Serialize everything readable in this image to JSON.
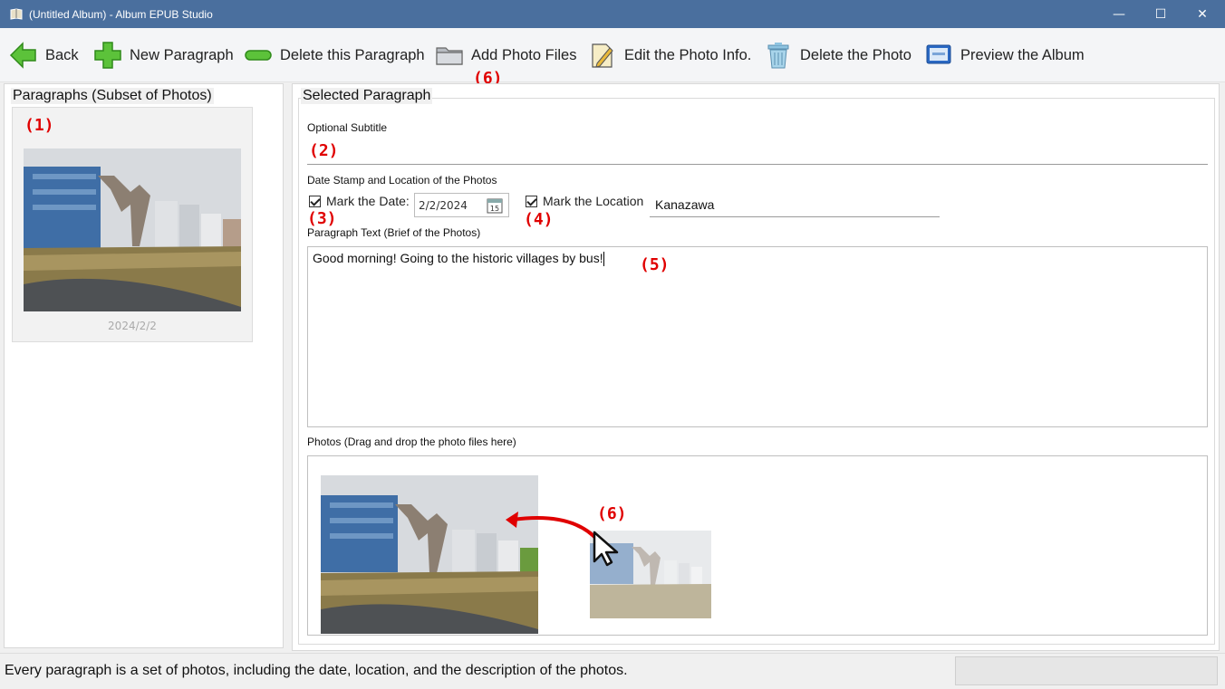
{
  "window": {
    "title": "(Untitled Album) - Album EPUB Studio",
    "minimize_glyph": "—",
    "maximize_glyph": "☐",
    "close_glyph": "✕"
  },
  "toolbar": {
    "back": "Back",
    "new_paragraph": "New Paragraph",
    "delete_paragraph": "Delete this Paragraph",
    "add_photo_files": "Add Photo Files",
    "edit_photo_info": "Edit the Photo Info.",
    "delete_photo": "Delete the Photo",
    "preview_album": "Preview the Album"
  },
  "annotations": {
    "m1": "(1)",
    "m2": "(2)",
    "m3": "(3)",
    "m4": "(4)",
    "m5": "(5)",
    "m6_toolbar": "(6)",
    "m6_drop": "(6)"
  },
  "left_panel": {
    "title": "Paragraphs (Subset of Photos)",
    "paragraphs": [
      {
        "date": "2024/2/2"
      }
    ]
  },
  "selected_paragraph": {
    "title": "Selected Paragraph",
    "subtitle_label": "Optional Subtitle",
    "subtitle_value": "",
    "date_location_label": "Date Stamp and Location of the Photos",
    "mark_date_label": "Mark the Date:",
    "mark_date_checked": true,
    "date_value": "2/2/2024",
    "calendar_day": "15",
    "mark_location_label": "Mark the Location",
    "mark_location_checked": true,
    "location_value": "Kanazawa",
    "paragraph_text_label": "Paragraph Text (Brief of the Photos)",
    "paragraph_text": "Good morning! Going to  the historic villages by bus!",
    "photos_label": "Photos (Drag and drop the photo files here)"
  },
  "statusbar": {
    "message": "Every paragraph is a set of photos, including the date, location, and the description of the photos."
  },
  "colors": {
    "titlebar": "#4a6f9e",
    "annotation_red": "#e00000",
    "back_green": "#5cc23a",
    "trash_blue": "#8ec3e0"
  }
}
